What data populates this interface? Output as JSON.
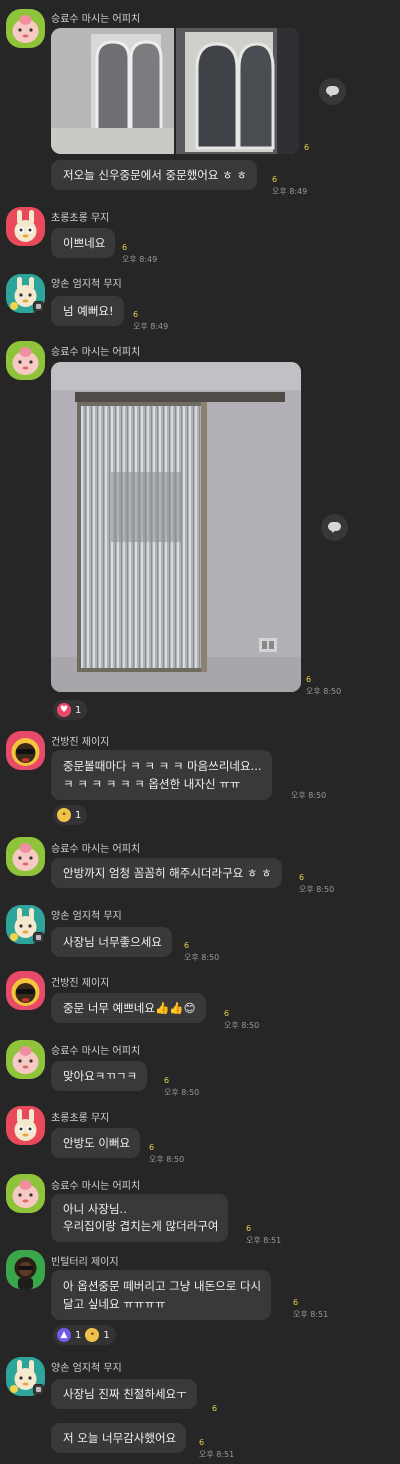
{
  "colors": {
    "background": "#262626",
    "bubble": "#393939",
    "unread": "#e8d14a",
    "time": "#9a9a9a"
  },
  "messages": {
    "m1": {
      "sender": "승료수 마시는 어피치",
      "unread": "6"
    },
    "m2": {
      "text": "저오늘 신우중문에서 중문했어요 ㅎ ㅎ",
      "unread": "6",
      "time": "오후 8:49"
    },
    "m3": {
      "sender": "초롱초롱 무지",
      "text": "이쁘네요",
      "unread": "6",
      "time": "오후 8:49"
    },
    "m4": {
      "sender": "양손 엄지척 무지",
      "text": "넘 예뻐요!",
      "unread": "6",
      "time": "오후 8:49"
    },
    "m5": {
      "sender": "승료수 마시는 어피치",
      "unread": "6",
      "time": "오후 8:50",
      "reaction_count": "1",
      "reaction_icon": "heart"
    },
    "m6": {
      "sender": "건방진 제이지",
      "line1": "중문볼때마다 ㅋ ㅋ ㅋ ㅋ 마음쓰리네요...",
      "line2": "ㅋ ㅋ ㅋ ㅋ ㅋ ㅋ 옵션한 내자신 ㅠㅠ",
      "time": "오후 8:50",
      "reaction_count": "1",
      "reaction_icon": "sad"
    },
    "m7": {
      "sender": "승료수 마시는 어피치",
      "text": "안방까지 엄청 꼼꼼히 해주시더라구요 ㅎ ㅎ",
      "unread": "6",
      "time": "오후 8:50"
    },
    "m8": {
      "sender": "양손 엄지척 무지",
      "text": "사장님 너무좋으세요",
      "unread": "6",
      "time": "오후 8:50"
    },
    "m9": {
      "sender": "건방진 제이지",
      "text": "중문 너무 예쁘네요👍👍😊",
      "unread": "6",
      "time": "오후 8:50"
    },
    "m10": {
      "sender": "승료수 마시는 어피치",
      "text": "맞아요ㅋㄲㄱㅋ",
      "unread": "6",
      "time": "오후 8:50"
    },
    "m11": {
      "sender": "초롱초롱 무지",
      "text": "안방도 이뻐요",
      "unread": "6",
      "time": "오후 8:50"
    },
    "m12": {
      "sender": "승료수 마시는 어피치",
      "line1": "아니 사장님..",
      "line2": "우리집이랑 겹치는게 많더라구여",
      "unread": "6",
      "time": "오후 8:51"
    },
    "m13": {
      "sender": "빈털터리 제이지",
      "line1": "아 옵션중문 떼버리고 그냥 내돈으로 다시",
      "line2": "달고 싶네요 ㅠㅠㅠㅠ",
      "unread": "6",
      "time": "오후 8:51",
      "reaction1_count": "1",
      "reaction1_icon": "like",
      "reaction2_icon": "sad",
      "reaction2_count": "1"
    },
    "m14": {
      "sender": "양손 엄지척 무지",
      "text": "사장님 진짜 친절하세요ㅜ",
      "unread": "6"
    },
    "m15": {
      "text": "저 오늘 너무감사했어요",
      "unread": "6",
      "time": "오후 8:51"
    }
  }
}
